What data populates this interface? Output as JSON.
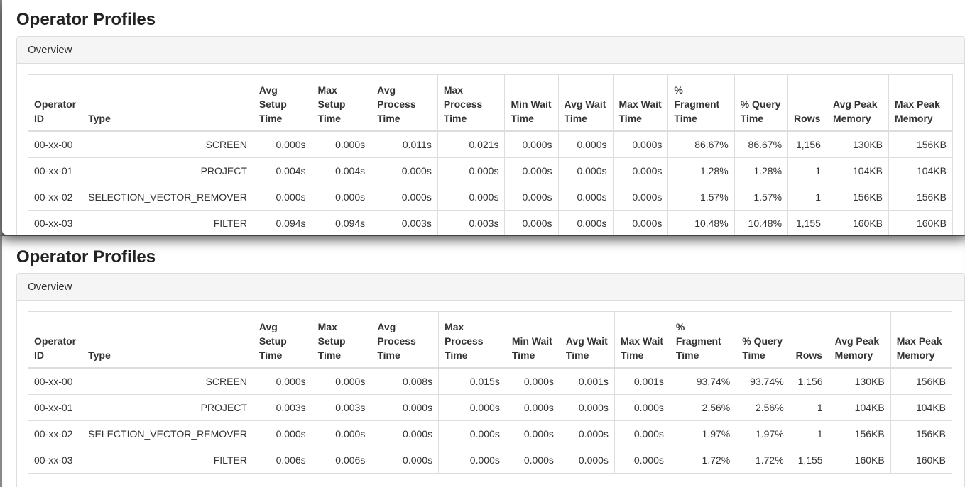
{
  "profiles": [
    {
      "title": "Operator Profiles",
      "panel_title": "Overview",
      "columns": [
        "Operator ID",
        "Type",
        "Avg Setup Time",
        "Max Setup Time",
        "Avg Process Time",
        "Max Process Time",
        "Min Wait Time",
        "Avg Wait Time",
        "Max Wait Time",
        "% Fragment Time",
        "% Query Time",
        "Rows",
        "Avg Peak Memory",
        "Max Peak Memory"
      ],
      "rows": [
        [
          "00-xx-00",
          "SCREEN",
          "0.000s",
          "0.000s",
          "0.011s",
          "0.021s",
          "0.000s",
          "0.000s",
          "0.000s",
          "86.67%",
          "86.67%",
          "1,156",
          "130KB",
          "156KB"
        ],
        [
          "00-xx-01",
          "PROJECT",
          "0.004s",
          "0.004s",
          "0.000s",
          "0.000s",
          "0.000s",
          "0.000s",
          "0.000s",
          "1.28%",
          "1.28%",
          "1",
          "104KB",
          "104KB"
        ],
        [
          "00-xx-02",
          "SELECTION_VECTOR_REMOVER",
          "0.000s",
          "0.000s",
          "0.000s",
          "0.000s",
          "0.000s",
          "0.000s",
          "0.000s",
          "1.57%",
          "1.57%",
          "1",
          "156KB",
          "156KB"
        ],
        [
          "00-xx-03",
          "FILTER",
          "0.094s",
          "0.094s",
          "0.003s",
          "0.003s",
          "0.000s",
          "0.000s",
          "0.000s",
          "10.48%",
          "10.48%",
          "1,155",
          "160KB",
          "160KB"
        ]
      ]
    },
    {
      "title": "Operator Profiles",
      "panel_title": "Overview",
      "columns": [
        "Operator ID",
        "Type",
        "Avg Setup Time",
        "Max Setup Time",
        "Avg Process Time",
        "Max Process Time",
        "Min Wait Time",
        "Avg Wait Time",
        "Max Wait Time",
        "% Fragment Time",
        "% Query Time",
        "Rows",
        "Avg Peak Memory",
        "Max Peak Memory"
      ],
      "rows": [
        [
          "00-xx-00",
          "SCREEN",
          "0.000s",
          "0.000s",
          "0.008s",
          "0.015s",
          "0.000s",
          "0.001s",
          "0.001s",
          "93.74%",
          "93.74%",
          "1,156",
          "130KB",
          "156KB"
        ],
        [
          "00-xx-01",
          "PROJECT",
          "0.003s",
          "0.003s",
          "0.000s",
          "0.000s",
          "0.000s",
          "0.000s",
          "0.000s",
          "2.56%",
          "2.56%",
          "1",
          "104KB",
          "104KB"
        ],
        [
          "00-xx-02",
          "SELECTION_VECTOR_REMOVER",
          "0.000s",
          "0.000s",
          "0.000s",
          "0.000s",
          "0.000s",
          "0.000s",
          "0.000s",
          "1.97%",
          "1.97%",
          "1",
          "156KB",
          "156KB"
        ],
        [
          "00-xx-03",
          "FILTER",
          "0.006s",
          "0.006s",
          "0.000s",
          "0.000s",
          "0.000s",
          "0.000s",
          "0.000s",
          "1.72%",
          "1.72%",
          "1,155",
          "160KB",
          "160KB"
        ]
      ]
    }
  ]
}
